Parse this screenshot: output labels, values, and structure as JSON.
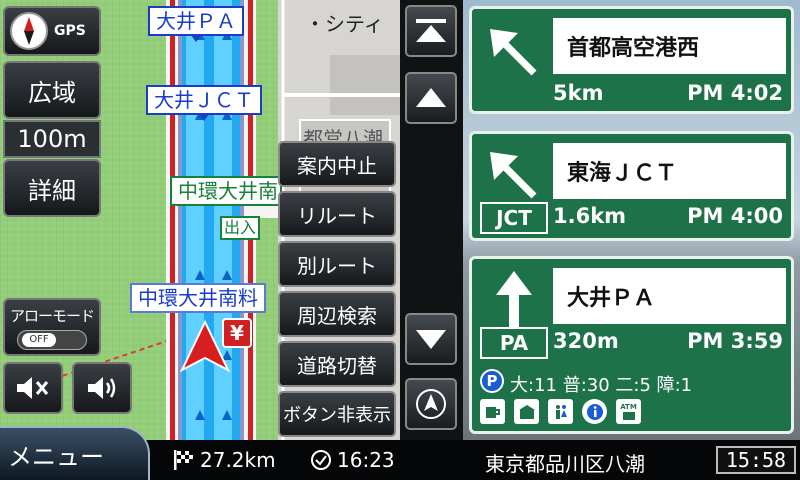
{
  "map": {
    "labels": {
      "oi_pa": "大井ＰＡ",
      "oi_jct": "大井ＪＣＴ",
      "chukan_oi": "中環大井南",
      "chukan_oi_minami": "中環大井南料",
      "exit_mark": "出入",
      "city": "・シティ",
      "area": "都営八潮"
    },
    "gps_label": "GPS",
    "wide_label": "広域",
    "scale": "100m",
    "detail_label": "詳細",
    "arrow_mode_label": "アローモード",
    "arrow_mode_state": "OFF",
    "atm_mark": "¥"
  },
  "popup_menu": {
    "items": [
      "案内中止",
      "リルート",
      "別ルート",
      "周辺検索",
      "道路切替",
      "ボタン非表示"
    ]
  },
  "guidance": {
    "signs": [
      {
        "name": "首都高空港西",
        "distance": "5km",
        "time": "PM 4:02",
        "badge": "",
        "arrow": "up-left"
      },
      {
        "name": "東海ＪＣＴ",
        "distance": "1.6km",
        "time": "PM 4:00",
        "badge": "JCT",
        "arrow": "up-left"
      },
      {
        "name": "大井ＰＡ",
        "distance": "320m",
        "time": "PM 3:59",
        "badge": "PA",
        "arrow": "up"
      }
    ],
    "parking_info": "大:11 普:30 二:5 障:1",
    "facility_icons": [
      "coffee-icon",
      "shop-icon",
      "restroom-icon",
      "info-icon",
      "atm-icon"
    ],
    "atm_text": "ATM"
  },
  "bottom_bar": {
    "menu_label": "メニュー",
    "remaining_distance": "27.2km",
    "arrival_time": "16:23",
    "address": "東京都品川区八潮",
    "clock": "15:58"
  },
  "colors": {
    "sign_green": "#1d7249",
    "route_blue": "#1e90ff",
    "map_grass": "#92cd78",
    "label_blue": "#1a3cc8"
  }
}
